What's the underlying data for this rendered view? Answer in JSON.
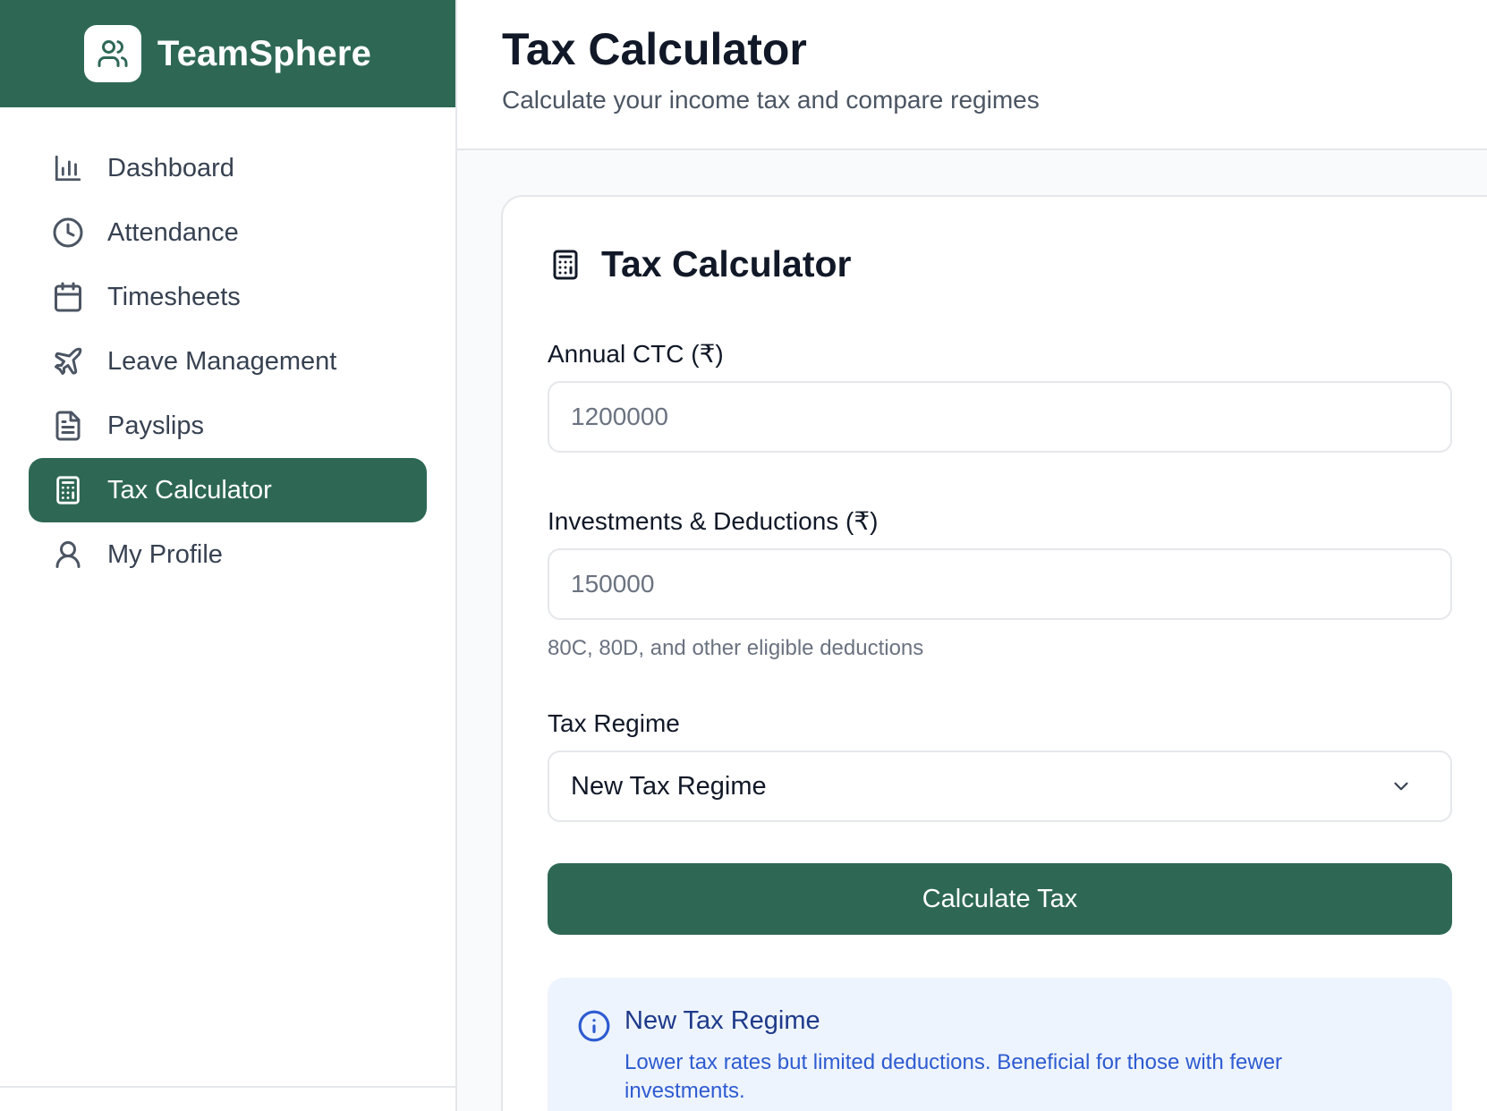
{
  "brand": {
    "name": "TeamSphere",
    "logo_icon": "users-icon"
  },
  "sidebar": {
    "items": [
      {
        "label": "Dashboard",
        "icon": "bar-chart-icon",
        "active": false
      },
      {
        "label": "Attendance",
        "icon": "clock-icon",
        "active": false
      },
      {
        "label": "Timesheets",
        "icon": "calendar-icon",
        "active": false
      },
      {
        "label": "Leave Management",
        "icon": "plane-icon",
        "active": false
      },
      {
        "label": "Payslips",
        "icon": "file-text-icon",
        "active": false
      },
      {
        "label": "Tax Calculator",
        "icon": "calculator-icon",
        "active": true
      },
      {
        "label": "My Profile",
        "icon": "user-icon",
        "active": false
      }
    ]
  },
  "header": {
    "title": "Tax Calculator",
    "subtitle": "Calculate your income tax and compare regimes"
  },
  "card": {
    "title": "Tax Calculator",
    "icon": "calculator-icon",
    "ctc": {
      "label": "Annual CTC (₹)",
      "placeholder": "1200000",
      "value": ""
    },
    "deductions": {
      "label": "Investments & Deductions (₹)",
      "placeholder": "150000",
      "value": "",
      "hint": "80C, 80D, and other eligible deductions"
    },
    "regime": {
      "label": "Tax Regime",
      "selected": "New Tax Regime"
    },
    "calculate_label": "Calculate Tax",
    "info": {
      "icon": "info-icon",
      "title": "New Tax Regime",
      "text": "Lower tax rates but limited deductions. Beneficial for those with fewer investments."
    }
  },
  "colors": {
    "brand": "#2e6855",
    "info_bg": "#eef4fd",
    "info_text": "#2d5bd1",
    "info_title": "#1e3a8a"
  }
}
